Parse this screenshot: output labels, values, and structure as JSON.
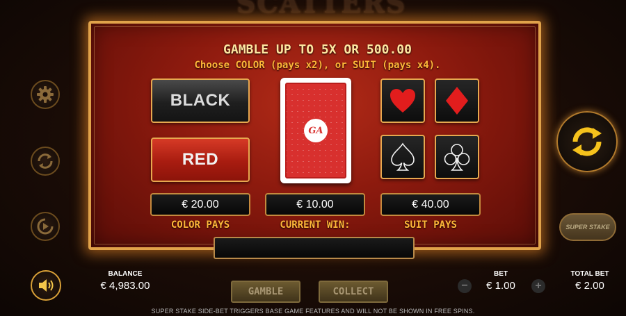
{
  "game": {
    "logo": "SCATTERS",
    "title": "GAMBLE UP TO 5X OR  500.00",
    "subtitle": "Choose COLOR (pays x2), or SUIT (pays x4)."
  },
  "colors": {
    "black_label": "BLACK",
    "red_label": "RED"
  },
  "card": {
    "logo_text": "GA"
  },
  "suits": {
    "hearts": "hearts-icon",
    "diamonds": "diamonds-icon",
    "spades": "spades-icon",
    "clubs": "clubs-icon"
  },
  "payouts": {
    "color_value": "€ 20.00",
    "current_value": "€ 10.00",
    "suit_value": "€ 40.00",
    "color_label": "COLOR PAYS",
    "current_label": "CURRENT WIN:",
    "suit_label": "SUIT PAYS"
  },
  "bottom": {
    "balance_label": "BALANCE",
    "balance_value": "€ 4,983.00",
    "bet_label": "BET",
    "bet_value": "€ 1.00",
    "total_bet_label": "TOTAL BET",
    "total_bet_value": "€ 2.00",
    "minus": "−",
    "plus": "+",
    "gamble_label": "GAMBLE",
    "collect_label": "COLLECT",
    "footer": "SUPER STAKE SIDE-BET TRIGGERS BASE GAME FEATURES AND WILL NOT BE SHOWN IN FREE SPINS."
  },
  "superstake": {
    "label": "SUPER STAKE"
  },
  "accent": {
    "gold": "#ffb739",
    "frame": "#e0a24a",
    "red": "#d8302e"
  }
}
